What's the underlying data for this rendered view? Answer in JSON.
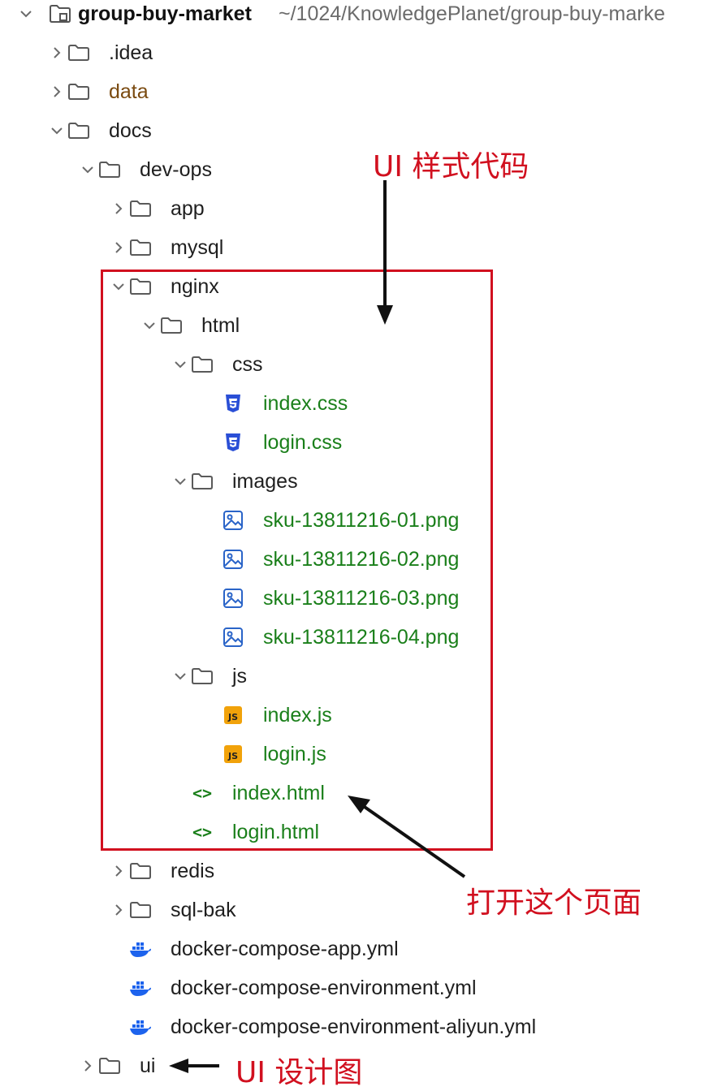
{
  "project": {
    "name": "group-buy-market",
    "path": "~/1024/KnowledgePlanet/group-buy-marke"
  },
  "tree": [
    {
      "label": ".idea",
      "icon": "folder-icon",
      "chevron": "right",
      "color": "default"
    },
    {
      "label": "data",
      "icon": "folder-icon",
      "chevron": "right",
      "color": "brown"
    },
    {
      "label": "docs",
      "icon": "folder-icon",
      "chevron": "down",
      "color": "default"
    },
    {
      "label": "dev-ops",
      "icon": "folder-icon",
      "chevron": "down",
      "color": "default"
    },
    {
      "label": "app",
      "icon": "folder-icon",
      "chevron": "right",
      "color": "default"
    },
    {
      "label": "mysql",
      "icon": "folder-icon",
      "chevron": "right",
      "color": "default"
    },
    {
      "label": "nginx",
      "icon": "folder-icon",
      "chevron": "down",
      "color": "default"
    },
    {
      "label": "html",
      "icon": "folder-icon",
      "chevron": "down",
      "color": "default"
    },
    {
      "label": "css",
      "icon": "folder-icon",
      "chevron": "down",
      "color": "default"
    },
    {
      "label": "index.css",
      "icon": "css-file-icon",
      "chevron": "none",
      "color": "green"
    },
    {
      "label": "login.css",
      "icon": "css-file-icon",
      "chevron": "none",
      "color": "green"
    },
    {
      "label": "images",
      "icon": "folder-icon",
      "chevron": "down",
      "color": "default"
    },
    {
      "label": "sku-13811216-01.png",
      "icon": "image-file-icon",
      "chevron": "none",
      "color": "green"
    },
    {
      "label": "sku-13811216-02.png",
      "icon": "image-file-icon",
      "chevron": "none",
      "color": "green"
    },
    {
      "label": "sku-13811216-03.png",
      "icon": "image-file-icon",
      "chevron": "none",
      "color": "green"
    },
    {
      "label": "sku-13811216-04.png",
      "icon": "image-file-icon",
      "chevron": "none",
      "color": "green"
    },
    {
      "label": "js",
      "icon": "folder-icon",
      "chevron": "down",
      "color": "default"
    },
    {
      "label": "index.js",
      "icon": "js-file-icon",
      "chevron": "none",
      "color": "green"
    },
    {
      "label": "login.js",
      "icon": "js-file-icon",
      "chevron": "none",
      "color": "green"
    },
    {
      "label": "index.html",
      "icon": "html-file-icon",
      "chevron": "none",
      "color": "green"
    },
    {
      "label": "login.html",
      "icon": "html-file-icon",
      "chevron": "none",
      "color": "green"
    },
    {
      "label": "redis",
      "icon": "folder-icon",
      "chevron": "right",
      "color": "default"
    },
    {
      "label": "sql-bak",
      "icon": "folder-icon",
      "chevron": "right",
      "color": "default"
    },
    {
      "label": "docker-compose-app.yml",
      "icon": "docker-icon",
      "chevron": "none",
      "color": "default"
    },
    {
      "label": "docker-compose-environment.yml",
      "icon": "docker-icon",
      "chevron": "none",
      "color": "default"
    },
    {
      "label": "docker-compose-environment-aliyun.yml",
      "icon": "docker-icon",
      "chevron": "none",
      "color": "default"
    },
    {
      "label": "ui",
      "icon": "folder-icon",
      "chevron": "right",
      "color": "default"
    }
  ],
  "annotations": {
    "ui_style_code": "UI 样式代码",
    "open_this_page": "打开这个页面",
    "ui_design": "UI 设计图"
  },
  "colors": {
    "annotation_red": "#d1101f",
    "vcs_green": "#1a7f1a",
    "ignored_brown": "#7a4a10",
    "css_blue": "#2a4fd6",
    "js_orange": "#f1a20a",
    "docker_blue": "#1d63ed"
  }
}
